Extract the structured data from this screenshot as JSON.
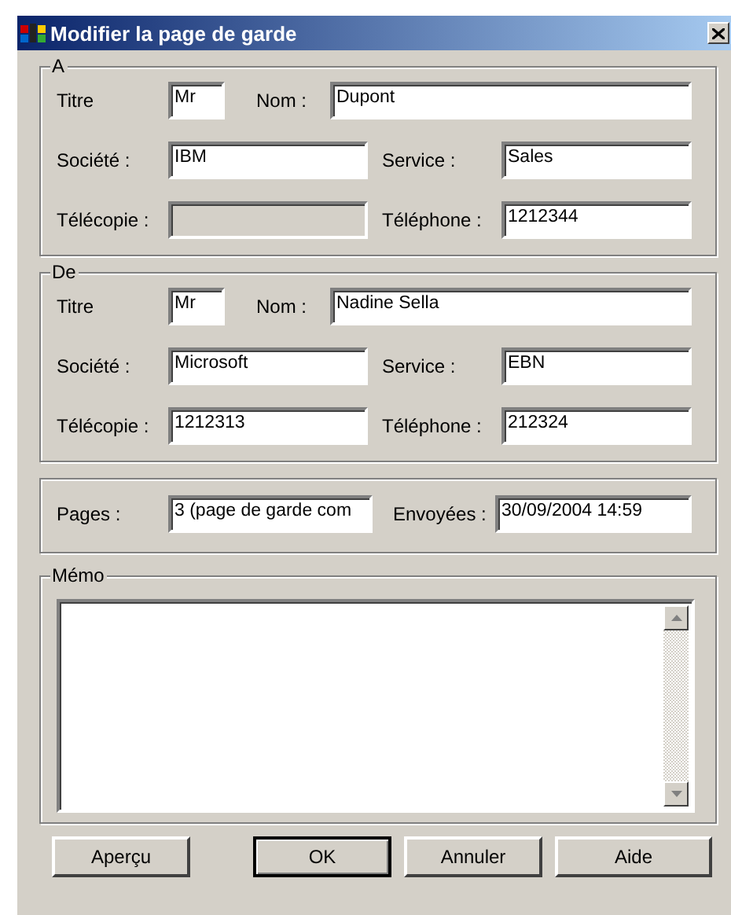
{
  "window": {
    "title": "Modifier la page de garde"
  },
  "groups": [
    {
      "kind": "contact",
      "legend": "A",
      "fields": [
        {
          "label": "Titre",
          "value": "Mr",
          "disabled": false
        },
        {
          "label": "Nom :",
          "value": "Dupont",
          "disabled": false
        },
        {
          "label": "Société :",
          "value": "IBM",
          "disabled": false
        },
        {
          "label": "Service :",
          "value": "Sales",
          "disabled": false
        },
        {
          "label": "Télécopie :",
          "disabled": true
        },
        {
          "label": "Téléphone :",
          "value": "1212344",
          "disabled": false
        }
      ]
    },
    {
      "kind": "contact",
      "legend": "De",
      "fields": [
        {
          "label": "Titre",
          "value": "Mr",
          "disabled": false
        },
        {
          "label": "Nom :",
          "value": "Nadine Sella",
          "disabled": false
        },
        {
          "label": "Société :",
          "value": "Microsoft",
          "disabled": false
        },
        {
          "label": "Service :",
          "value": "EBN",
          "disabled": false
        },
        {
          "label": "Télécopie :",
          "value": "1212313",
          "disabled": false
        },
        {
          "label": "Téléphone :",
          "value": "212324",
          "disabled": false
        }
      ]
    },
    {
      "kind": "info",
      "fields": [
        {
          "label": "Pages :",
          "value": "3 (page de garde com",
          "disabled": false
        },
        {
          "label": "Envoyées :",
          "value": "30/09/2004 14:59",
          "disabled": false
        }
      ]
    },
    {
      "kind": "memo",
      "legend": "Mémo"
    }
  ],
  "buttons": [
    {
      "label": "Aperçu",
      "default": false
    },
    {
      "label": "OK",
      "default": true
    },
    {
      "label": "Annuler",
      "default": false
    },
    {
      "label": "Aide",
      "default": false
    }
  ]
}
